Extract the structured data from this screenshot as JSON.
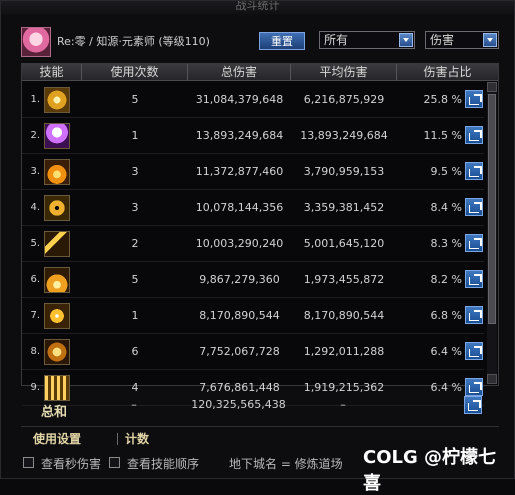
{
  "window": {
    "title": "战斗统计"
  },
  "header": {
    "character": "Re:零 / 知源·元素师 (等级110)",
    "reset_label": "重置",
    "filter_target": "所有",
    "filter_type": "伤害"
  },
  "columns": [
    "技能",
    "使用次数",
    "总伤害",
    "平均伤害",
    "伤害占比"
  ],
  "rows": [
    {
      "rank": "1.",
      "count": "5",
      "total": "31,084,379,648",
      "avg": "6,216,875,929",
      "pct": "25.8 %",
      "icon": "skill-icon-1"
    },
    {
      "rank": "2.",
      "count": "1",
      "total": "13,893,249,684",
      "avg": "13,893,249,684",
      "pct": "11.5 %",
      "icon": "skill-icon-2"
    },
    {
      "rank": "3.",
      "count": "3",
      "total": "11,372,877,460",
      "avg": "3,790,959,153",
      "pct": "9.5 %",
      "icon": "skill-icon-3"
    },
    {
      "rank": "4.",
      "count": "3",
      "total": "10,078,144,356",
      "avg": "3,359,381,452",
      "pct": "8.4 %",
      "icon": "skill-icon-4"
    },
    {
      "rank": "5.",
      "count": "2",
      "total": "10,003,290,240",
      "avg": "5,001,645,120",
      "pct": "8.3 %",
      "icon": "skill-icon-5"
    },
    {
      "rank": "6.",
      "count": "5",
      "total": "9,867,279,360",
      "avg": "1,973,455,872",
      "pct": "8.2 %",
      "icon": "skill-icon-6"
    },
    {
      "rank": "7.",
      "count": "1",
      "total": "8,170,890,544",
      "avg": "8,170,890,544",
      "pct": "6.8 %",
      "icon": "skill-icon-7"
    },
    {
      "rank": "8.",
      "count": "6",
      "total": "7,752,067,728",
      "avg": "1,292,011,288",
      "pct": "6.4 %",
      "icon": "skill-icon-8"
    },
    {
      "rank": "9.",
      "count": "4",
      "total": "7,676,861,448",
      "avg": "1,919,215,362",
      "pct": "6.4 %",
      "icon": "skill-icon-9"
    }
  ],
  "total": {
    "label": "总和",
    "count": "–",
    "total": "120,325,565,438",
    "avg": "–"
  },
  "tabs": [
    "使用设置",
    "计数"
  ],
  "footer": {
    "check1": "查看秒伤害",
    "check2": "查看技能顺序",
    "dungeon": "地下城名 = 修炼道场"
  },
  "watermark": "COLG @柠檬七喜",
  "colors": {
    "accent": "#2a5ba6",
    "gold": "#e2d5a5"
  }
}
